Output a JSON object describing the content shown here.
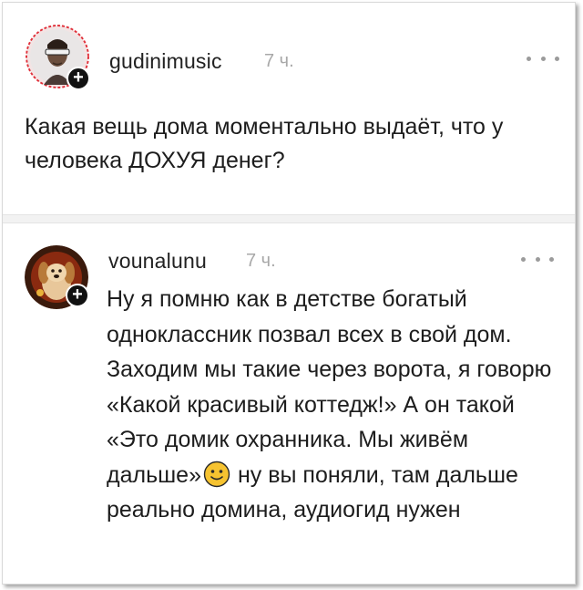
{
  "post": {
    "author": "gudinimusic",
    "time": "7 ч.",
    "text": "Какая вещь дома моментально выдаёт, что у человека ДОХУЯ денег?",
    "avatar_icon": "user-avatar-sunglasses",
    "add_icon": "plus-icon",
    "more_icon": "more-dots-icon"
  },
  "reply": {
    "author": "vounalunu",
    "time": "7 ч.",
    "text_before_emoji": "Ну я помню как в детстве богатый одноклассник позвал всех в свой дом. Заходим мы такие через ворота, я говорю «Какой красивый коттедж!» А он такой «Это домик охранника. Мы живём дальше»",
    "text_after_emoji": "ну вы поняли, там дальше реально домина, аудиогид нужен",
    "emoji": "slightly-smiling-face-icon",
    "avatar_icon": "user-avatar-dog",
    "add_icon": "plus-icon",
    "more_icon": "more-dots-icon"
  },
  "colors": {
    "text": "#1d1d1d",
    "muted": "#a8a8a8",
    "avatar_ring_post": "#e0303a",
    "avatar_bg_reply": "#3a1a0c",
    "emoji_yellow": "#f6c330"
  }
}
